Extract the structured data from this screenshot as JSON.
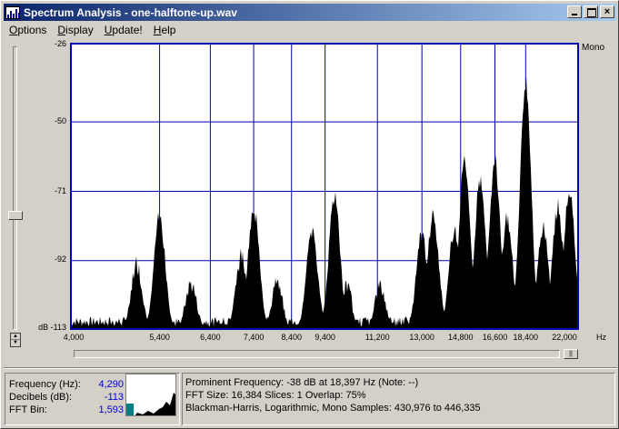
{
  "window": {
    "title": "Spectrum Analysis - one-halftone-up.wav",
    "minimize_label": "",
    "close_label": "×"
  },
  "menu": {
    "items": [
      {
        "label": "Options",
        "u": "O",
        "rest": "ptions"
      },
      {
        "label": "Display",
        "u": "D",
        "rest": "isplay"
      },
      {
        "label": "Update!",
        "u": "U",
        "rest": "pdate!"
      },
      {
        "label": "Help",
        "u": "H",
        "rest": "elp"
      }
    ]
  },
  "plot": {
    "channel_label": "Mono",
    "y_unit": "dB",
    "x_unit": "Hz",
    "y_ticks": [
      "-26",
      "-50",
      "-71",
      "-92",
      "-113"
    ],
    "x_ticks": [
      "4,000",
      "5,400",
      "6,400",
      "7,400",
      "8,400",
      "9,400",
      "11,200",
      "13,000",
      "14,800",
      "16,600",
      "18,400",
      "22,000"
    ],
    "colors": {
      "background": "#ffffff",
      "grid": "#0000aa",
      "spectrum": "#000000"
    }
  },
  "chart_data": {
    "type": "area",
    "title": "",
    "xlabel": "Hz",
    "ylabel": "dB",
    "x_scale": "log",
    "xlim": [
      4000,
      22000
    ],
    "ylim": [
      -113,
      -26
    ],
    "series": [
      {
        "peaks_hz": [
          5000,
          5400,
          6000,
          7100,
          7400,
          8000,
          9000,
          9700,
          10100,
          11300,
          13000,
          13500,
          14500,
          15000,
          15800,
          16600,
          17300,
          18397,
          19500,
          20500,
          21300
        ],
        "peaks_db": [
          -93,
          -79,
          -99,
          -91,
          -76,
          -99,
          -83,
          -73,
          -100,
          -100,
          -84,
          -78,
          -82,
          -62,
          -68,
          -62,
          -79,
          -38,
          -82,
          -76,
          -70
        ]
      }
    ]
  },
  "status": {
    "frequency_label": "Frequency (Hz):",
    "frequency_value": "4,290",
    "decibels_label": "Decibels (dB):",
    "decibels_value": "-113",
    "fft_bin_label": "FFT Bin:",
    "fft_bin_value": "1,593",
    "line1": "Prominent Frequency: -38 dB at 18,397 Hz (Note: --)",
    "line2": "FFT Size: 16,384  Slices: 1   Overlap: 75%",
    "line3": "Blackman-Harris, Logarithmic, Mono  Samples: 430,976 to 446,335"
  }
}
